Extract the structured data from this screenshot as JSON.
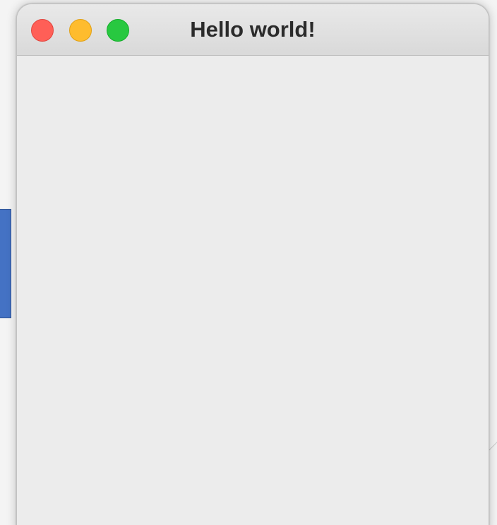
{
  "window": {
    "title": "Hello world!",
    "controls": {
      "close": {
        "icon": "close-icon",
        "color": "#ff5f57"
      },
      "minimize": {
        "icon": "minimize-icon",
        "color": "#febc2e"
      },
      "maximize": {
        "icon": "maximize-icon",
        "color": "#28c840"
      }
    },
    "content_background": "#ececec"
  },
  "background": {
    "left_shape_color": "#4472c4"
  }
}
